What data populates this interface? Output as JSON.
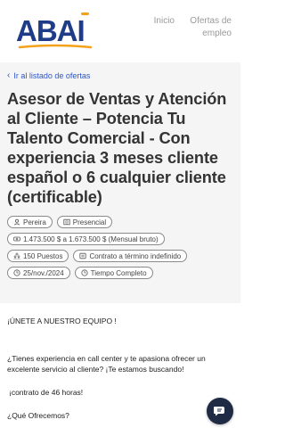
{
  "header": {
    "logo_text": "ABAI",
    "nav": {
      "inicio": "Inicio",
      "ofertas": "Ofertas de empleo"
    }
  },
  "back_link": "Ir al listado de ofertas",
  "job": {
    "title": "Asesor de Ventas y Atención al Cliente – Potencia Tu Talento Comercial - Con experiencia 3 meses cliente español o 6 cualquier cliente (certificable)",
    "location": "Pereira",
    "modality": "Presencial",
    "salary": "1.473.500 $ a 1.673.500 $ (Mensual bruto)",
    "positions": "150 Puestos",
    "contract": "Contrato a término indefinido",
    "date": "25/nov./2024",
    "schedule": "Tiempo Completo"
  },
  "description": {
    "p1": "¡ÚNETE A NUESTRO EQUIPO !",
    "p2": "¿Tienes experiencia en call center y te apasiona ofrecer un excelente servicio al cliente? ¡Te estamos buscando!",
    "p3": "¡contrato de 46 horas!",
    "p4": "¿Qué Ofrecemos?"
  },
  "colors": {
    "brand_blue": "#1f3c88",
    "brand_orange": "#f4a21b",
    "link_blue": "#2e56c9",
    "fab_bg": "#1f2a44"
  },
  "icons": [
    "location-icon",
    "building-icon",
    "money-icon",
    "people-icon",
    "document-icon",
    "clock-icon",
    "chat-icon"
  ]
}
